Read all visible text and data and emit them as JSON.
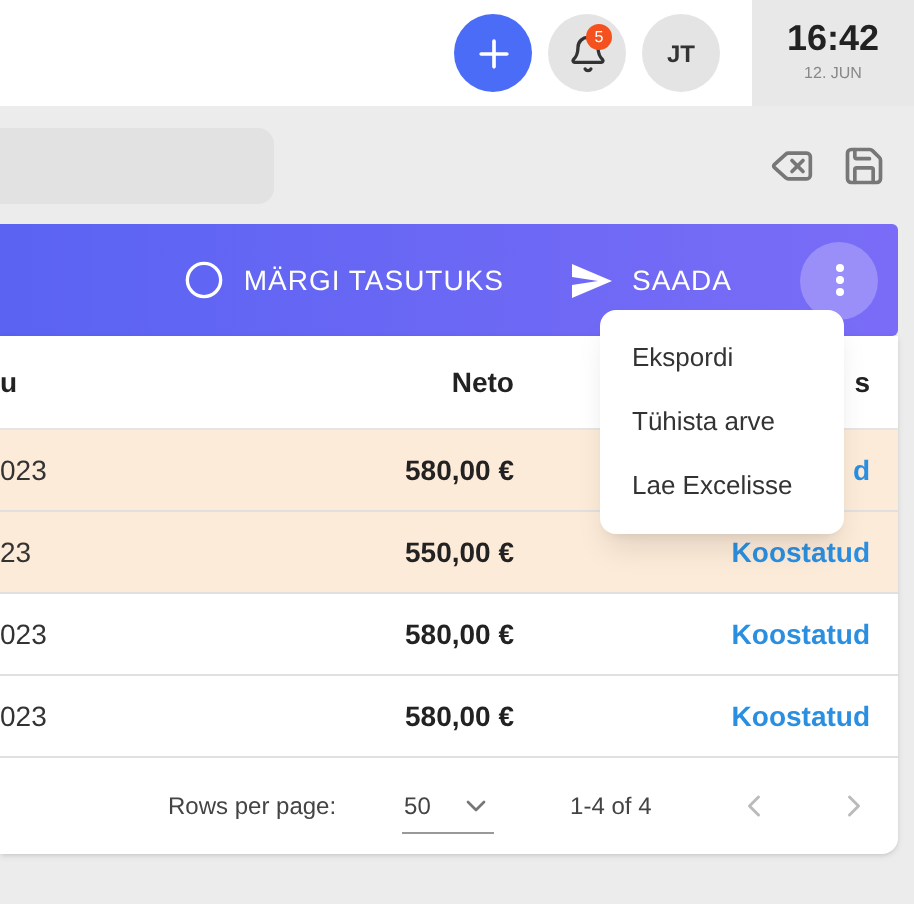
{
  "header": {
    "notification_count": "5",
    "user_initials": "JT",
    "clock": {
      "time": "16:42",
      "date": "12. JUN"
    }
  },
  "toolbar": {
    "actions": [
      {
        "kind": "mark",
        "label": "MÄRGI TASUTUKS"
      },
      {
        "kind": "send",
        "label": "SAADA"
      }
    ]
  },
  "menu": {
    "items": [
      "Ekspordi",
      "Tühista arve",
      "Lae Excelisse"
    ]
  },
  "table": {
    "columns": [
      "u",
      "Neto",
      "s"
    ],
    "rows": [
      {
        "highlighted": true,
        "cells": [
          "023",
          "580,00 €",
          "d"
        ]
      },
      {
        "highlighted": true,
        "cells": [
          "23",
          "550,00 €",
          "Koostatud"
        ]
      },
      {
        "highlighted": false,
        "cells": [
          "023",
          "580,00 €",
          "Koostatud"
        ]
      },
      {
        "highlighted": false,
        "cells": [
          "023",
          "580,00 €",
          "Koostatud"
        ]
      }
    ]
  },
  "pagination": {
    "rows_per_page_label": "Rows per page:",
    "rows_per_page": "50",
    "range": "1-4 of 4"
  }
}
